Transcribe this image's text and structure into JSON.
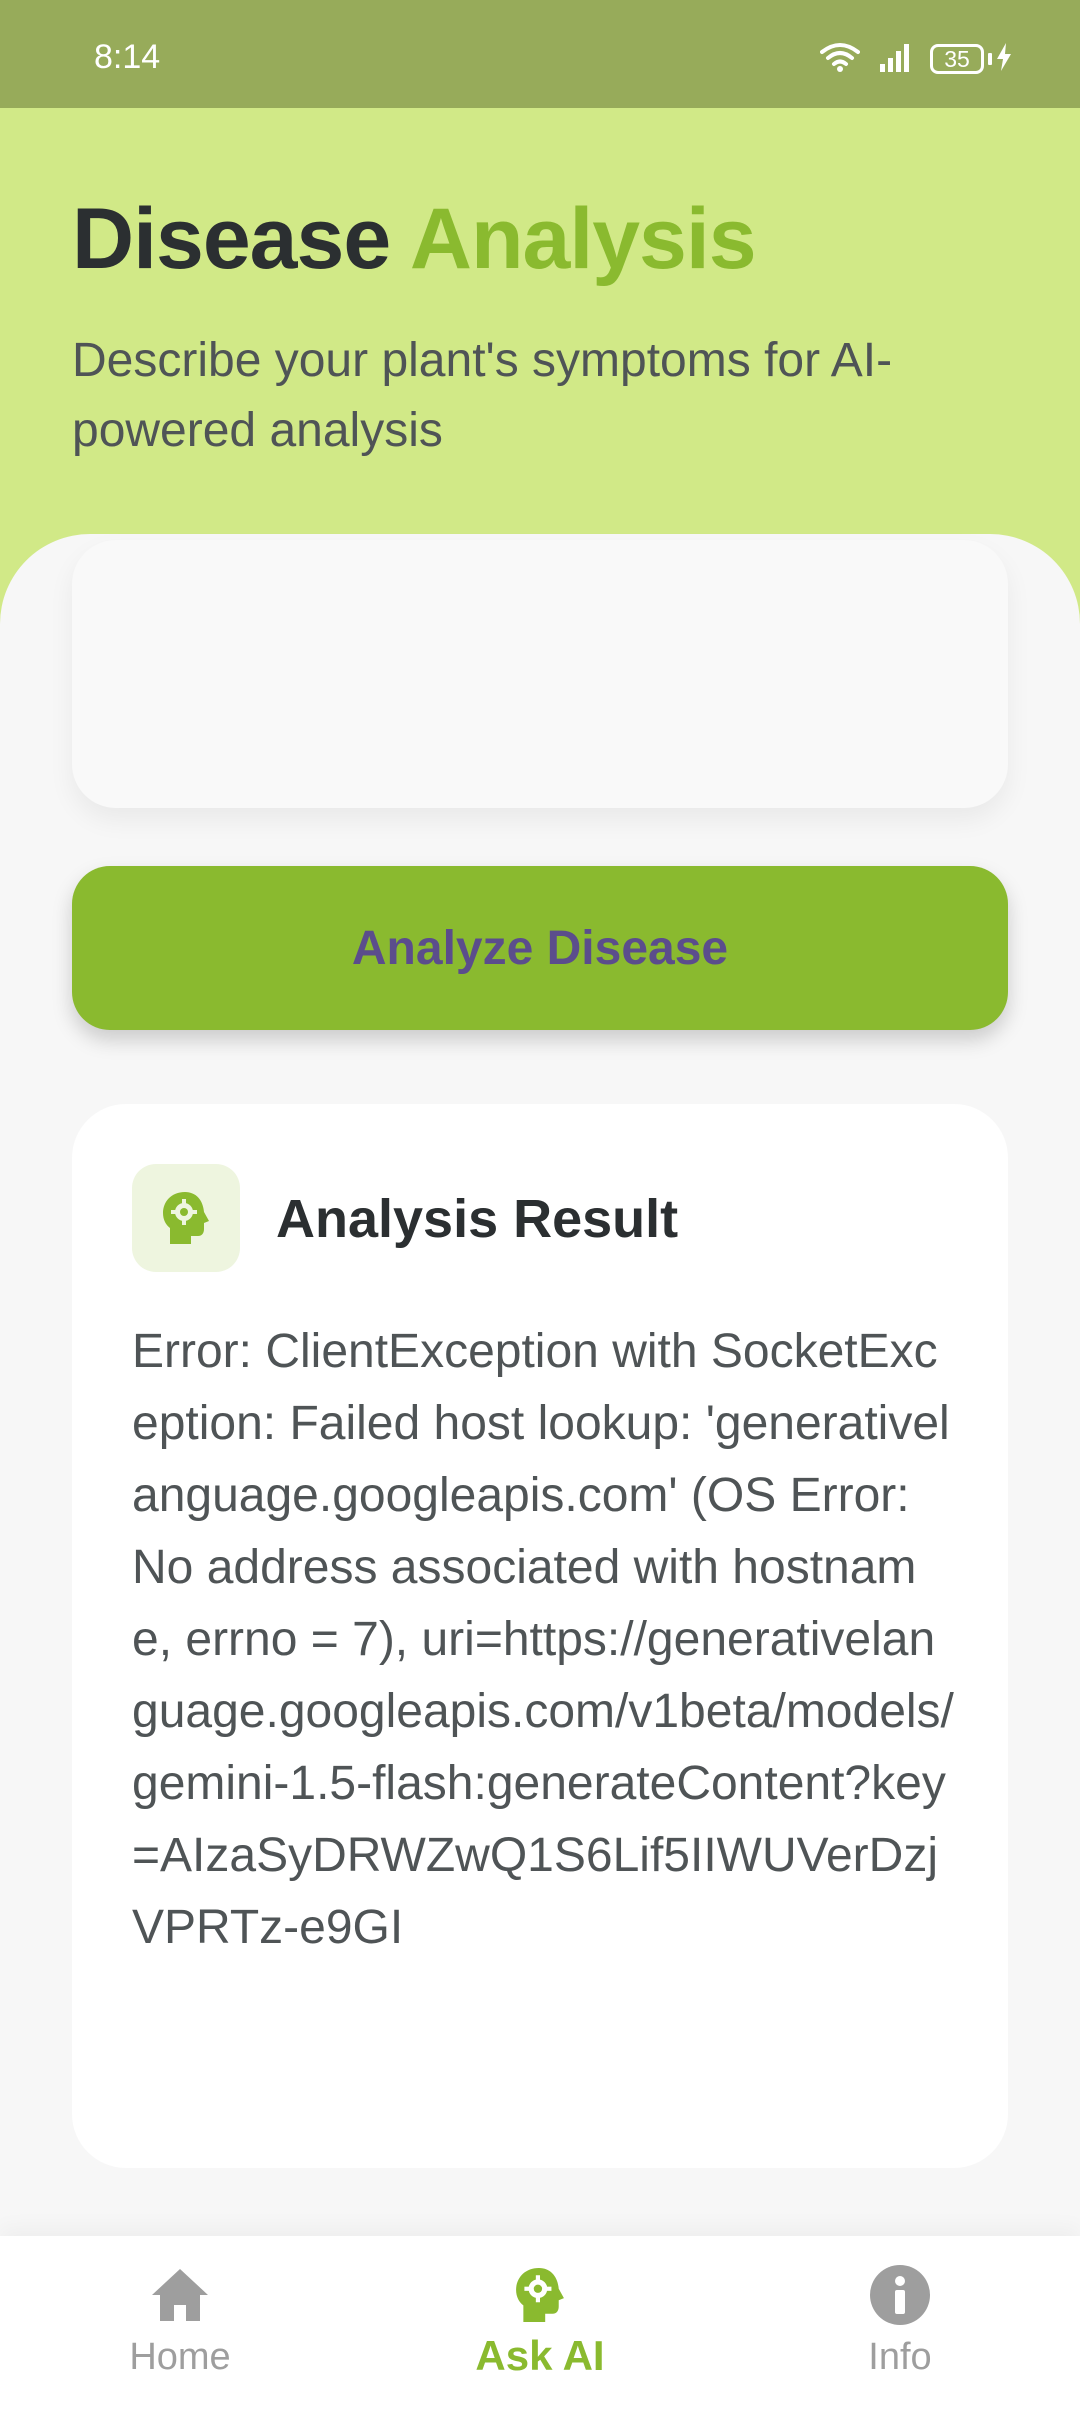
{
  "status_bar": {
    "time": "8:14",
    "battery": "35"
  },
  "header": {
    "title_main": "Disease",
    "title_accent": "Analysis",
    "subtitle": "Describe your plant's symptoms for AI-powered analysis"
  },
  "symptoms_input": {
    "value": ""
  },
  "analyze_button": {
    "label": "Analyze Disease"
  },
  "result": {
    "title": "Analysis Result",
    "text": "Error: ClientException with SocketException: Failed host lookup: 'generativelanguage.googleapis.com' (OS Error: No address associated with hostname, errno = 7), uri=https://generativelanguage.googleapis.com/v1beta/models/gemini-1.5-flash:generateContent?key=AIzaSyDRWZwQ1S6Lif5IIWUVerDzjVPRTz-e9GI",
    "icon": "ai-brain-icon"
  },
  "bottom_nav": {
    "items": [
      {
        "label": "Home",
        "icon": "home-icon",
        "active": false
      },
      {
        "label": "Ask AI",
        "icon": "ai-brain-icon",
        "active": true
      },
      {
        "label": "Info",
        "icon": "info-icon",
        "active": false
      }
    ]
  },
  "colors": {
    "accent": "#8aba2f",
    "header_bg": "#d1e987",
    "status_bar_bg": "#97ab5a",
    "button_text": "#5b4d8c",
    "inactive_nav": "#9e9e9e"
  }
}
